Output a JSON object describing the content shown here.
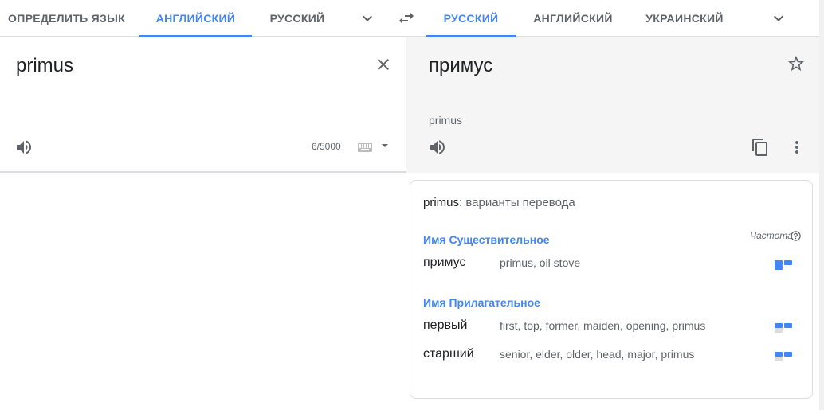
{
  "source_langs": [
    {
      "label": "ОПРЕДЕЛИТЬ ЯЗЫК",
      "active": false
    },
    {
      "label": "АНГЛИЙСКИЙ",
      "active": true
    },
    {
      "label": "РУССКИЙ",
      "active": false
    }
  ],
  "target_langs": [
    {
      "label": "РУССКИЙ",
      "active": true
    },
    {
      "label": "АНГЛИЙСКИЙ",
      "active": false
    },
    {
      "label": "УКРАИНСКИЙ",
      "active": false
    }
  ],
  "source": {
    "text": "primus",
    "char_count": "6/5000"
  },
  "target": {
    "text": "примус",
    "transliteration": "primus"
  },
  "dictionary": {
    "headword": "primus",
    "heading_suffix": ": варианты перевода",
    "frequency_label": "Частота",
    "sections": [
      {
        "pos": "Имя Существительное",
        "entries": [
          {
            "word": "примус",
            "synonyms": "primus, oil stove",
            "frequency": 3
          }
        ]
      },
      {
        "pos": "Имя Прилагательное",
        "entries": [
          {
            "word": "первый",
            "synonyms": "first, top, former, maiden, opening, primus",
            "frequency": 2
          },
          {
            "word": "старший",
            "synonyms": "senior, elder, older, head, major, primus",
            "frequency": 2
          }
        ]
      }
    ]
  },
  "icons": {
    "swap": "swap-languages-icon",
    "clear": "close-icon",
    "speaker": "speaker-icon",
    "keyboard": "keyboard-icon",
    "star": "star-icon",
    "copy": "copy-icon",
    "more": "more-vert-icon",
    "help": "help-icon"
  },
  "colors": {
    "accent": "#4285f4",
    "text_primary": "#202124",
    "text_secondary": "#5f6368",
    "target_bg": "#f5f5f5"
  }
}
